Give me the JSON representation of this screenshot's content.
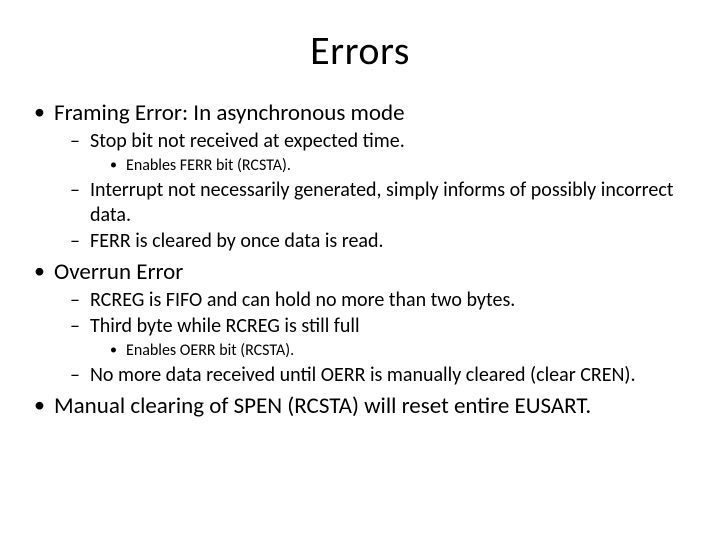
{
  "title": "Errors",
  "bullets": {
    "a": "Framing Error: In asynchronous mode",
    "a1": "Stop bit not received at expected time.",
    "a1a": "Enables FERR bit (RCSTA).",
    "a2": "Interrupt not necessarily generated, simply informs of possibly incorrect data.",
    "a3": "FERR is cleared by once data is read.",
    "b": "Overrun Error",
    "b1": "RCREG is FIFO and can hold no more than two bytes.",
    "b2": "Third byte while RCREG is still full",
    "b2a": "Enables OERR bit (RCSTA).",
    "b3": "No more data received until OERR is manually cleared (clear CREN).",
    "c": "Manual clearing of SPEN (RCSTA) will reset entire EUSART."
  }
}
